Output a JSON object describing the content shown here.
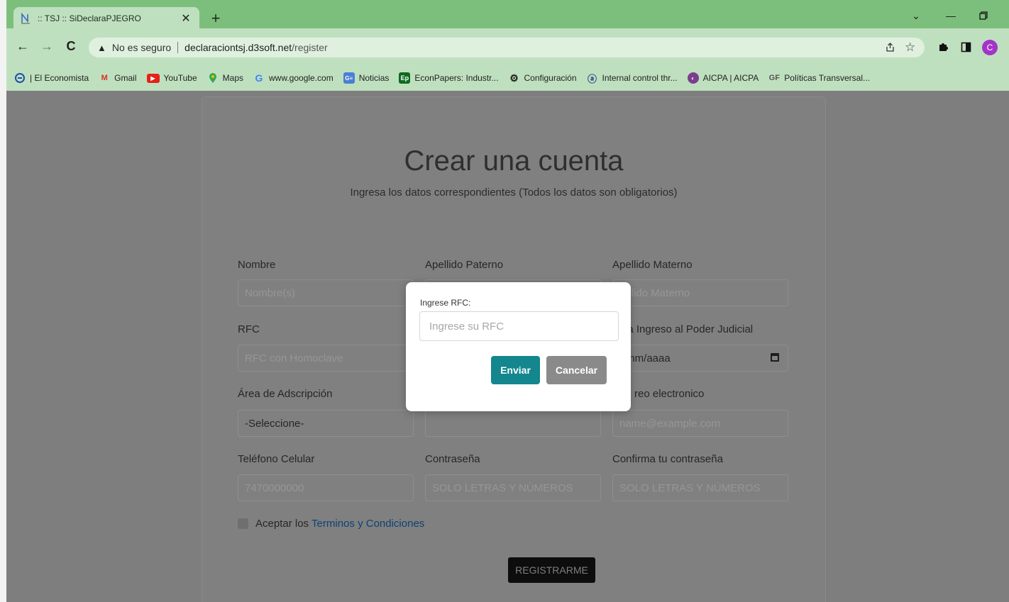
{
  "browser": {
    "tab_title": ":: TSJ :: SiDeclaraPJEGRO",
    "new_tab": "+",
    "security_label": "No es seguro",
    "url_host": "declaracionts j.d3soft.net",
    "url_host_display": "declaraciontsj.d3soft.net",
    "url_path": "/register",
    "profile_initial": "C"
  },
  "bookmarks": [
    {
      "label": "| El Economista",
      "icon": "economista-icon"
    },
    {
      "label": "Gmail",
      "icon": "gmail-icon"
    },
    {
      "label": "YouTube",
      "icon": "youtube-icon"
    },
    {
      "label": "Maps",
      "icon": "maps-icon"
    },
    {
      "label": "www.google.com",
      "icon": "google-icon"
    },
    {
      "label": "Noticias",
      "icon": "news-icon"
    },
    {
      "label": "EconPapers: Industr...",
      "icon": "econpapers-icon"
    },
    {
      "label": "Configuración",
      "icon": "settings-icon"
    },
    {
      "label": "Internal control thr...",
      "icon": "ic-icon"
    },
    {
      "label": "AICPA | AICPA",
      "icon": "aicpa-icon"
    },
    {
      "label": "Políticas Transversal...",
      "icon": "politicas-icon"
    }
  ],
  "form": {
    "title": "Crear una cuenta",
    "subtitle": "Ingresa los datos correspondientes (Todos los datos son obligatorios)",
    "fields": {
      "nombre": {
        "label": "Nombre",
        "placeholder": "Nombre(s)"
      },
      "apellido_paterno": {
        "label": "Apellido Paterno"
      },
      "apellido_materno": {
        "label": "Apellido Materno",
        "placeholder": "ellido Materno"
      },
      "rfc": {
        "label": "RFC",
        "placeholder": "RFC con Homoclave"
      },
      "fecha_ingreso": {
        "label": "na Ingreso al Poder Judicial",
        "value": "/mm/aaaa"
      },
      "area": {
        "label": "Área de Adscripción",
        "value": "-Seleccione-"
      },
      "correo": {
        "label": "reo electronico",
        "placeholder": "name@example.com"
      },
      "telefono": {
        "label": "Teléfono Celular",
        "placeholder": "7470000000"
      },
      "contrasena": {
        "label": "Contraseña",
        "placeholder": "SOLO LETRAS Y NÚMEROS"
      },
      "confirma": {
        "label": "Confirma tu contraseña",
        "placeholder": "SOLO LETRAS Y NÚMEROS"
      }
    },
    "terms_prefix": "Aceptar los",
    "terms_link": "Terminos y Condiciones",
    "register_button": "REGISTRARME"
  },
  "modal": {
    "label": "Ingrese RFC:",
    "placeholder": "Ingrese su RFC",
    "submit": "Enviar",
    "cancel": "Cancelar"
  },
  "colors": {
    "chrome": "#7cbf7c",
    "toolbar": "#bfe0bf",
    "overlay": "#7e7e7e",
    "accent": "#13868e"
  }
}
